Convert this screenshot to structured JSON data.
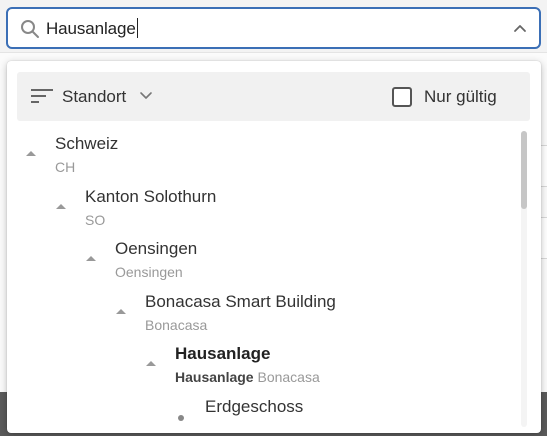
{
  "search": {
    "value": "Hausanlage"
  },
  "toolbar": {
    "sort_label": "Standort",
    "checkbox_label": "Nur gültig",
    "checkbox_checked": false
  },
  "tree": {
    "nodes": [
      {
        "name": "Schweiz",
        "sub": "CH",
        "sub_highlight": ""
      },
      {
        "name": "Kanton Solothurn",
        "sub": "SO",
        "sub_highlight": ""
      },
      {
        "name": "Oensingen",
        "sub": "Oensingen",
        "sub_highlight": ""
      },
      {
        "name": "Bonacasa Smart Building",
        "sub": "Bonacasa",
        "sub_highlight": ""
      },
      {
        "name": "Hausanlage",
        "sub": "Bonacasa",
        "sub_highlight": "Hausanlage"
      },
      {
        "name": "Erdgeschoss",
        "sub": "",
        "sub_highlight": ""
      }
    ]
  },
  "colors": {
    "accent": "#3b6fb6",
    "text": "#333333",
    "muted": "#999999"
  }
}
